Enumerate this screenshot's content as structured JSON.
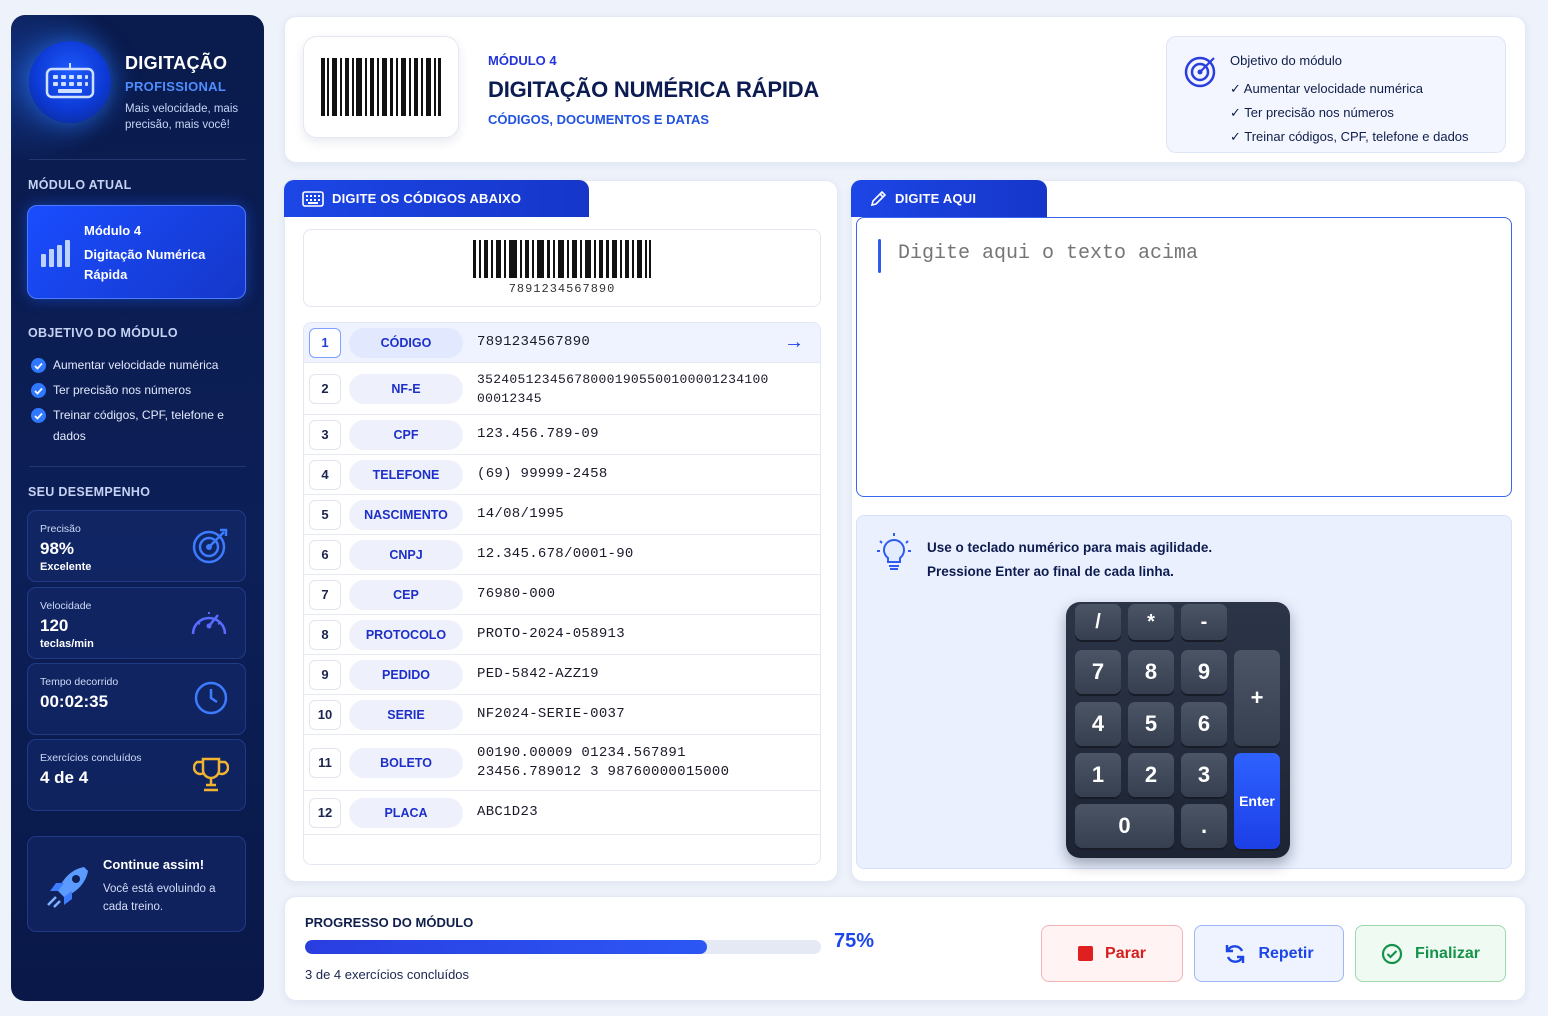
{
  "sidebar": {
    "brand_title": "DIGITAÇÃO",
    "brand_subtitle": "PROFISSIONAL",
    "brand_tagline": "Mais velocidade, mais precisão, mais você!",
    "current_module_heading": "MÓDULO ATUAL",
    "current_module": {
      "number": "Módulo 4",
      "name": "Digitação Numérica Rápida"
    },
    "objectives_heading": "OBJETIVO DO MÓDULO",
    "objectives": [
      "Aumentar velocidade numérica",
      "Ter precisão nos números",
      "Treinar códigos, CPF, telefone e dados"
    ],
    "performance_heading": "SEU DESEMPENHO",
    "stats": [
      {
        "label": "Precisão",
        "value": "98%",
        "unit": "Excelente",
        "icon": "target-icon"
      },
      {
        "label": "Velocidade",
        "value": "120",
        "unit": "teclas/min",
        "icon": "speedometer-icon"
      },
      {
        "label": "Tempo decorrido",
        "value": "00:02:35",
        "unit": "",
        "icon": "clock-icon"
      },
      {
        "label": "Exercícios concluídos",
        "value": "4 de 4",
        "unit": "",
        "icon": "trophy-icon"
      }
    ],
    "motivation": {
      "title": "Continue assim!",
      "text": "Você está evoluindo a cada treino."
    }
  },
  "header": {
    "module_label": "MÓDULO 4",
    "title": "DIGITAÇÃO NUMÉRICA RÁPIDA",
    "subtitle": "CÓDIGOS, DOCUMENTOS E DATAS",
    "objective_title": "Objetivo do módulo",
    "objectives": [
      "✓ Aumentar velocidade numérica",
      "✓ Ter precisão nos números",
      "✓ Treinar códigos, CPF, telefone e dados"
    ]
  },
  "codes_panel": {
    "tab_label": "DIGITE OS CÓDIGOS ABAIXO",
    "barcode_number": "7891234567890",
    "rows": [
      {
        "idx": "1",
        "label": "CÓDIGO",
        "value": "7891234567890",
        "active": true
      },
      {
        "idx": "2",
        "label": "NF-E",
        "value": "352405123456780001905500100001234100\n00012345"
      },
      {
        "idx": "3",
        "label": "CPF",
        "value": "123.456.789-09"
      },
      {
        "idx": "4",
        "label": "TELEFONE",
        "value": "(69) 99999-2458"
      },
      {
        "idx": "5",
        "label": "NASCIMENTO",
        "value": "14/08/1995"
      },
      {
        "idx": "6",
        "label": "CNPJ",
        "value": "12.345.678/0001-90"
      },
      {
        "idx": "7",
        "label": "CEP",
        "value": "76980-000"
      },
      {
        "idx": "8",
        "label": "PROTOCOLO",
        "value": "PROTO-2024-058913"
      },
      {
        "idx": "9",
        "label": "PEDIDO",
        "value": "PED-5842-AZZ19"
      },
      {
        "idx": "10",
        "label": "SERIE",
        "value": "NF2024-SERIE-0037"
      },
      {
        "idx": "11",
        "label": "BOLETO",
        "value": "00190.00009 01234.567891\n23456.789012 3 98760000015000"
      },
      {
        "idx": "12",
        "label": "PLACA",
        "value": "ABC1D23"
      }
    ],
    "active_arrow": "→"
  },
  "type_panel": {
    "tab_label": "DIGITE AQUI",
    "placeholder": "Digite aqui o texto acima",
    "tip_line1": "Use o teclado numérico para mais agilidade.",
    "tip_line2": "Pressione Enter ao final de cada linha.",
    "keys": {
      "slash": "/",
      "star": "*",
      "minus": "-",
      "k7": "7",
      "k8": "8",
      "k9": "9",
      "plus": "+",
      "k4": "4",
      "k5": "5",
      "k6": "6",
      "k1": "1",
      "k2": "2",
      "k3": "3",
      "enter": "Enter",
      "k0": "0",
      "dot": "."
    }
  },
  "progress": {
    "heading": "PROGRESSO DO MÓDULO",
    "percent_label": "75%",
    "fraction": 0.78,
    "note": "3 de 4 exercícios concluídos"
  },
  "actions": {
    "stop": "Parar",
    "repeat": "Repetir",
    "finish": "Finalizar"
  },
  "colors": {
    "accent": "#1c46e6",
    "sidebar": "#0a1b4d",
    "stop": "#d62020",
    "finish": "#16934a"
  }
}
